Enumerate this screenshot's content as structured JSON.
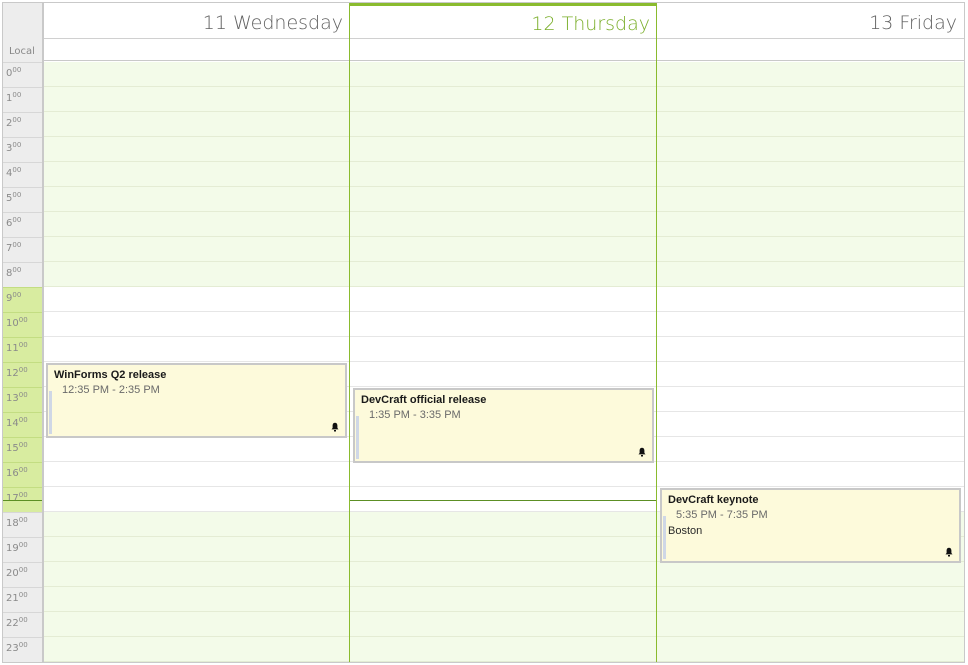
{
  "timezone_label": "Local",
  "hours": [
    {
      "h": "0",
      "m": "00"
    },
    {
      "h": "1",
      "m": "00"
    },
    {
      "h": "2",
      "m": "00"
    },
    {
      "h": "3",
      "m": "00"
    },
    {
      "h": "4",
      "m": "00"
    },
    {
      "h": "5",
      "m": "00"
    },
    {
      "h": "6",
      "m": "00"
    },
    {
      "h": "7",
      "m": "00"
    },
    {
      "h": "8",
      "m": "00"
    },
    {
      "h": "9",
      "m": "00"
    },
    {
      "h": "10",
      "m": "00"
    },
    {
      "h": "11",
      "m": "00"
    },
    {
      "h": "12",
      "m": "00"
    },
    {
      "h": "13",
      "m": "00"
    },
    {
      "h": "14",
      "m": "00"
    },
    {
      "h": "15",
      "m": "00"
    },
    {
      "h": "16",
      "m": "00"
    },
    {
      "h": "17",
      "m": "00"
    },
    {
      "h": "18",
      "m": "00"
    },
    {
      "h": "19",
      "m": "00"
    },
    {
      "h": "20",
      "m": "00"
    },
    {
      "h": "21",
      "m": "00"
    },
    {
      "h": "22",
      "m": "00"
    },
    {
      "h": "23",
      "m": "00"
    }
  ],
  "work_hours": {
    "start": 9,
    "end": 18
  },
  "current_time_hour": 17.55,
  "days": [
    {
      "header": "11 Wednesday",
      "today": false
    },
    {
      "header": "12 Thursday",
      "today": true
    },
    {
      "header": "13 Friday",
      "today": false
    }
  ],
  "appointments": [
    {
      "day": 0,
      "start": 12.0,
      "end": 15.0,
      "title": "WinForms  Q2 release",
      "time": "12:35 PM - 2:35 PM",
      "location": "",
      "reminder": true
    },
    {
      "day": 1,
      "start": 13.0,
      "end": 16.0,
      "title": "DevCraft official  release",
      "time": "1:35 PM - 3:35 PM",
      "location": "",
      "reminder": true
    },
    {
      "day": 2,
      "start": 17.0,
      "end": 20.0,
      "title": "DevCraft keynote",
      "time": "5:35 PM - 7:35 PM",
      "location": "Boston",
      "reminder": true
    }
  ],
  "colors": {
    "today_accent": "#8abb2e",
    "work_hour_label_bg": "#d8eca0",
    "off_hours_bg": "#f3fbe9",
    "appointment_bg": "#fdfadb"
  }
}
